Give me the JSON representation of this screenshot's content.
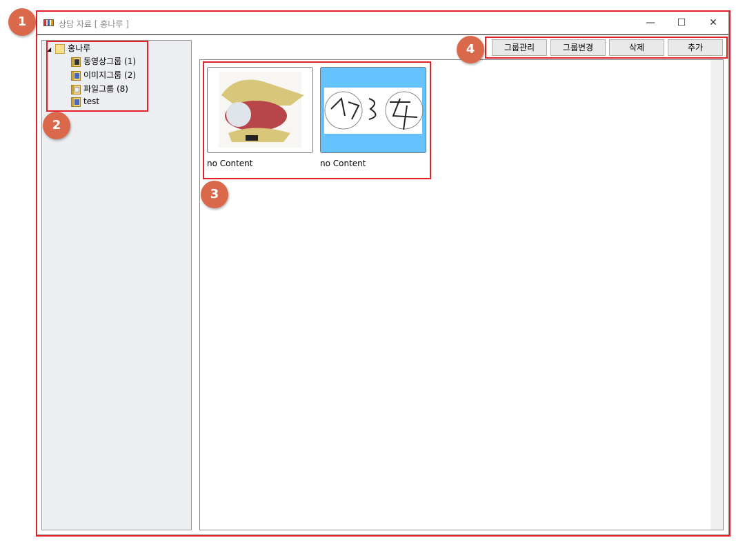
{
  "window": {
    "title": "상담 자료 [ 홍나루 ]",
    "minimize": "—",
    "maximize": "☐",
    "close": "✕"
  },
  "tree": {
    "root": "홍나루",
    "items": [
      {
        "label": "동영상그룹 (1)"
      },
      {
        "label": "이미지그룹 (2)"
      },
      {
        "label": "파일그룹 (8)"
      },
      {
        "label": "test"
      }
    ]
  },
  "toolbar": {
    "group_manage": "그룹관리",
    "group_change": "그룹변경",
    "delete": "삭제",
    "add": "추가"
  },
  "items": [
    {
      "caption": "no Content",
      "selected": false
    },
    {
      "caption": "no Content",
      "selected": true
    }
  ],
  "badges": [
    "1",
    "2",
    "3",
    "4"
  ],
  "colors": {
    "highlight": "#e3202a",
    "badge": "#d9694a",
    "selected": "#66c2ff"
  }
}
